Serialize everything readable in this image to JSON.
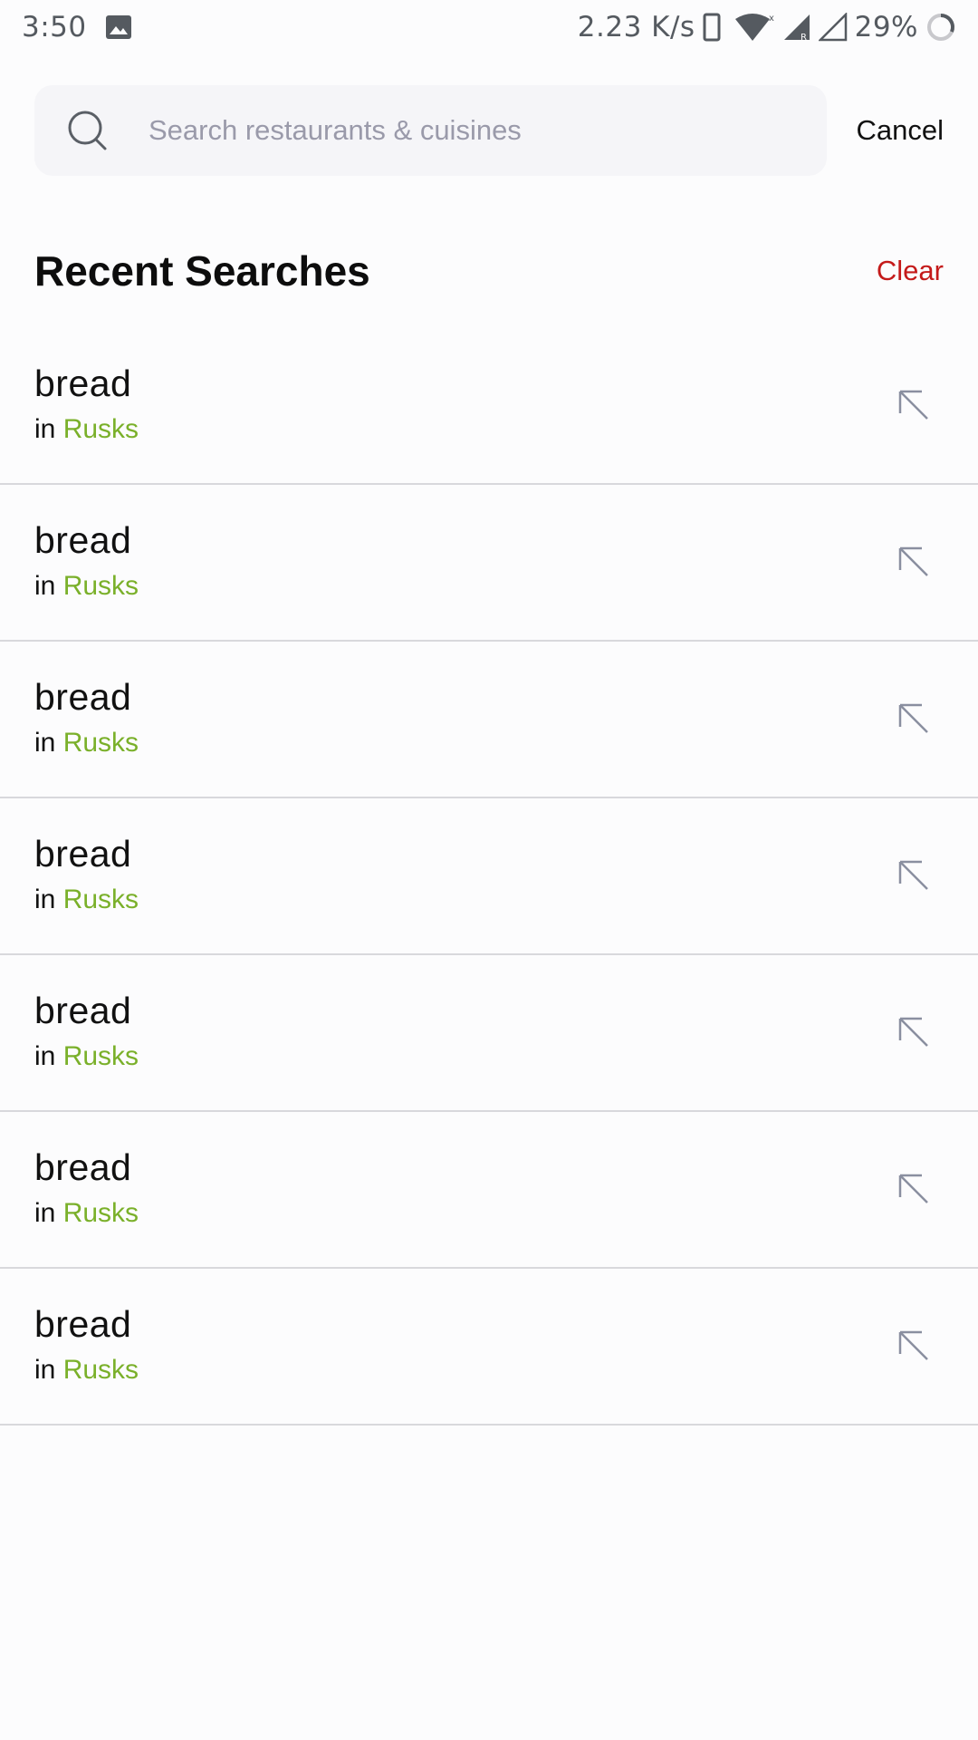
{
  "status_bar": {
    "time": "3:50",
    "network_speed": "2.23 K/s",
    "battery": "29%",
    "icons": [
      "image-icon",
      "phone-icon",
      "wifi-icon",
      "signal-icon",
      "signal-empty-icon",
      "battery-ring-icon"
    ]
  },
  "search": {
    "placeholder": "Search restaurants & cuisines",
    "value": "",
    "cancel_label": "Cancel"
  },
  "recent": {
    "title": "Recent Searches",
    "clear_label": "Clear",
    "items": [
      {
        "query": "bread",
        "prefix": "in",
        "category": "Rusks"
      },
      {
        "query": "bread",
        "prefix": "in",
        "category": "Rusks"
      },
      {
        "query": "bread",
        "prefix": "in",
        "category": "Rusks"
      },
      {
        "query": "bread",
        "prefix": "in",
        "category": "Rusks"
      },
      {
        "query": "bread",
        "prefix": "in",
        "category": "Rusks"
      },
      {
        "query": "bread",
        "prefix": "in",
        "category": "Rusks"
      },
      {
        "query": "bread",
        "prefix": "in",
        "category": "Rusks"
      }
    ]
  },
  "colors": {
    "accent_red": "#c41a1a",
    "category_green": "#7ab02a",
    "placeholder_gray": "#9a9aaa",
    "search_bg": "#f5f5f8",
    "divider": "#d8d8dc"
  }
}
